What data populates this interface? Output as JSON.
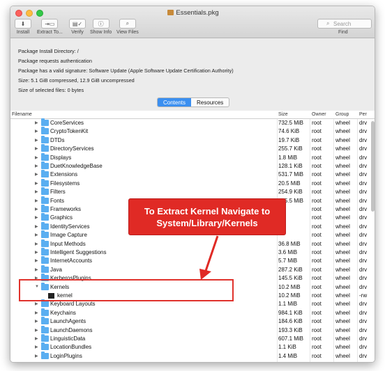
{
  "window": {
    "title": "Essentials.pkg"
  },
  "toolbar": {
    "install_label": "Install",
    "extract_label": "Extract To...",
    "verify_label": "Verify",
    "show_info_label": "Show Info",
    "view_files_label": "View Files",
    "search_placeholder": "Search",
    "find_label": "Find"
  },
  "info": {
    "install_directory": "Package Install Directory: /",
    "auth": "Package requests authentication",
    "signature": "Package has a valid signature: Software Update (Apple Software Update Certification Authority)",
    "size": "Size: 5.1 GiB compressed, 12.9 GiB uncompressed",
    "selected_size": "Size of selected files: 0 bytes"
  },
  "tabs": {
    "contents": "Contents",
    "resources": "Resources",
    "active": "Contents"
  },
  "table": {
    "headers": {
      "filename": "Filename",
      "size": "Size",
      "owner": "Owner",
      "group": "Group",
      "perm": "Per"
    },
    "rows": [
      {
        "name": "CoreServices",
        "size": "732.5 MiB",
        "owner": "root",
        "group": "wheel",
        "perm": "drv",
        "type": "folder"
      },
      {
        "name": "CryptoTokenKit",
        "size": "74.6 KiB",
        "owner": "root",
        "group": "wheel",
        "perm": "drv",
        "type": "folder"
      },
      {
        "name": "DTDs",
        "size": "19.7 KiB",
        "owner": "root",
        "group": "wheel",
        "perm": "drv",
        "type": "folder"
      },
      {
        "name": "DirectoryServices",
        "size": "255.7 KiB",
        "owner": "root",
        "group": "wheel",
        "perm": "drv",
        "type": "folder"
      },
      {
        "name": "Displays",
        "size": "1.8 MiB",
        "owner": "root",
        "group": "wheel",
        "perm": "drv",
        "type": "folder"
      },
      {
        "name": "DuetKnowledgeBase",
        "size": "128.1 KiB",
        "owner": "root",
        "group": "wheel",
        "perm": "drv",
        "type": "folder"
      },
      {
        "name": "Extensions",
        "size": "531.7 MiB",
        "owner": "root",
        "group": "wheel",
        "perm": "drv",
        "type": "folder"
      },
      {
        "name": "Filesystems",
        "size": "20.5 MiB",
        "owner": "root",
        "group": "wheel",
        "perm": "drv",
        "type": "folder"
      },
      {
        "name": "Filters",
        "size": "254.9 KiB",
        "owner": "root",
        "group": "wheel",
        "perm": "drv",
        "type": "folder"
      },
      {
        "name": "Fonts",
        "size": "445.5 MiB",
        "owner": "root",
        "group": "wheel",
        "perm": "drv",
        "type": "folder"
      },
      {
        "name": "Frameworks",
        "size": "",
        "owner": "root",
        "group": "wheel",
        "perm": "drv",
        "type": "folder"
      },
      {
        "name": "Graphics",
        "size": "",
        "owner": "root",
        "group": "wheel",
        "perm": "drv",
        "type": "folder"
      },
      {
        "name": "IdentityServices",
        "size": "",
        "owner": "root",
        "group": "wheel",
        "perm": "drv",
        "type": "folder"
      },
      {
        "name": "Image Capture",
        "size": "",
        "owner": "root",
        "group": "wheel",
        "perm": "drv",
        "type": "folder"
      },
      {
        "name": "Input Methods",
        "size": "36.8 MiB",
        "owner": "root",
        "group": "wheel",
        "perm": "drv",
        "type": "folder"
      },
      {
        "name": "Intelligent Suggestions",
        "size": "3.6 MiB",
        "owner": "root",
        "group": "wheel",
        "perm": "drv",
        "type": "folder"
      },
      {
        "name": "InternetAccounts",
        "size": "5.7 MiB",
        "owner": "root",
        "group": "wheel",
        "perm": "drv",
        "type": "folder"
      },
      {
        "name": "Java",
        "size": "287.2 KiB",
        "owner": "root",
        "group": "wheel",
        "perm": "drv",
        "type": "folder"
      },
      {
        "name": "KerberosPlugins",
        "size": "145.5 KiB",
        "owner": "root",
        "group": "wheel",
        "perm": "drv",
        "type": "folder"
      },
      {
        "name": "Kernels",
        "size": "10.2 MiB",
        "owner": "root",
        "group": "wheel",
        "perm": "drv",
        "type": "folder-open"
      },
      {
        "name": "kernel",
        "size": "10.2 MiB",
        "owner": "root",
        "group": "wheel",
        "perm": "-rw",
        "type": "file"
      },
      {
        "name": "Keyboard Layouts",
        "size": "1.1 MiB",
        "owner": "root",
        "group": "wheel",
        "perm": "drv",
        "type": "folder"
      },
      {
        "name": "Keychains",
        "size": "984.1 KiB",
        "owner": "root",
        "group": "wheel",
        "perm": "drv",
        "type": "folder"
      },
      {
        "name": "LaunchAgents",
        "size": "184.6 KiB",
        "owner": "root",
        "group": "wheel",
        "perm": "drv",
        "type": "folder"
      },
      {
        "name": "LaunchDaemons",
        "size": "193.3 KiB",
        "owner": "root",
        "group": "wheel",
        "perm": "drv",
        "type": "folder"
      },
      {
        "name": "LinguisticData",
        "size": "607.1 MiB",
        "owner": "root",
        "group": "wheel",
        "perm": "drv",
        "type": "folder"
      },
      {
        "name": "LocationBundles",
        "size": "1.1 KiB",
        "owner": "root",
        "group": "wheel",
        "perm": "drv",
        "type": "folder"
      },
      {
        "name": "LoginPlugins",
        "size": "1.4 MiB",
        "owner": "root",
        "group": "wheel",
        "perm": "drv",
        "type": "folder"
      }
    ]
  },
  "callout": {
    "line1": "To Extract Kernel Navigate to",
    "line2": "System/Library/Kernels",
    "color": "#e02a25"
  },
  "colors": {
    "accent": "#3b8ff0",
    "folder": "#5aaef1"
  }
}
